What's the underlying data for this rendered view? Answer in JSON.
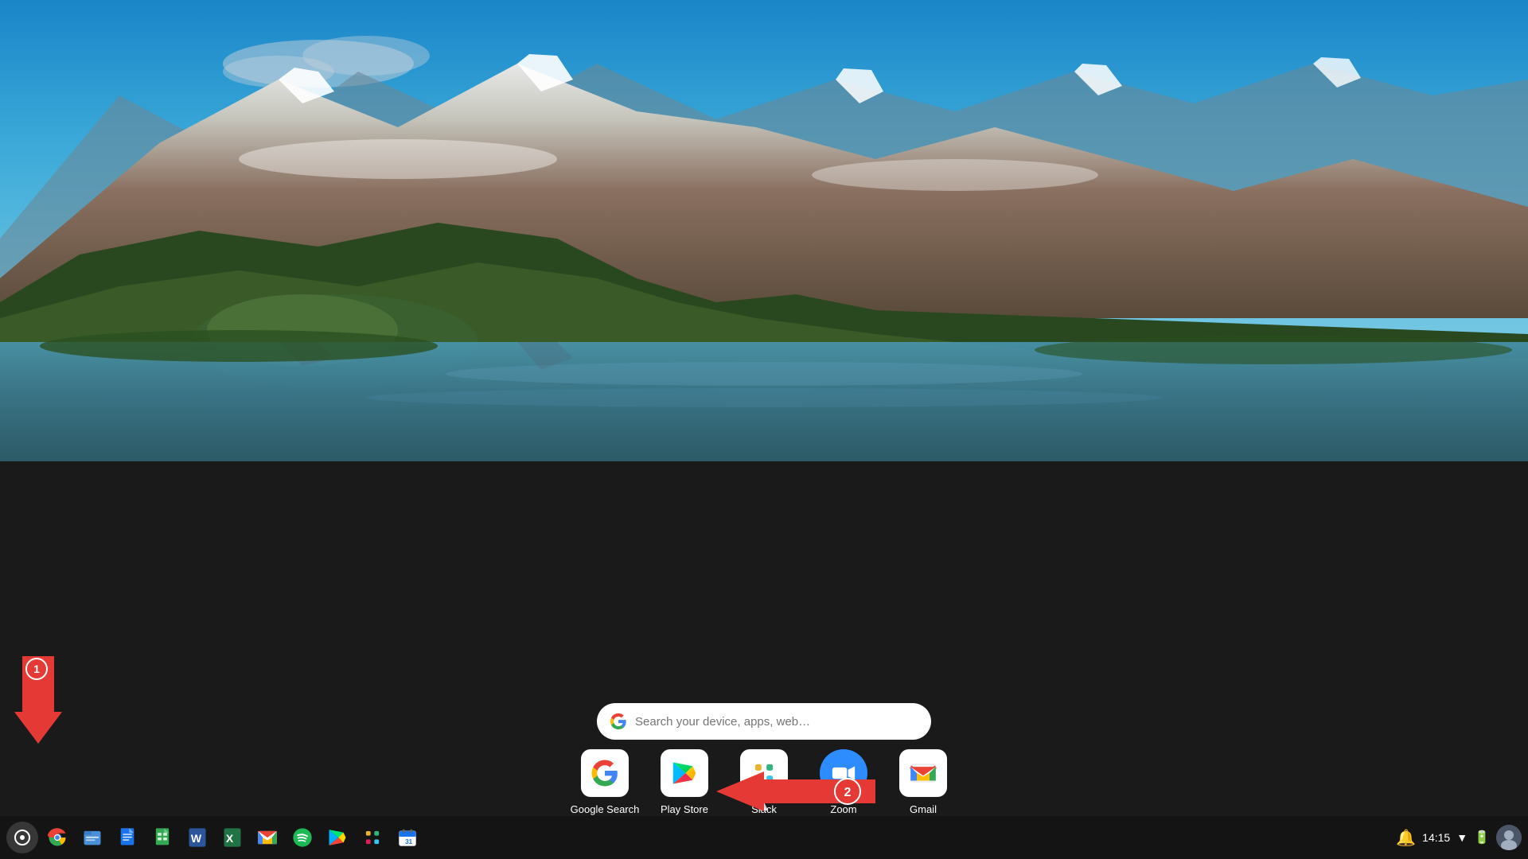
{
  "wallpaper": {
    "description": "Mountain landscape with lake reflection and blue sky"
  },
  "launcher": {
    "search_placeholder": "Search your device, apps, web…",
    "apps": [
      {
        "id": "google-search",
        "label": "Google Search",
        "icon": "google-search-icon",
        "color": "#ffffff"
      },
      {
        "id": "play-store",
        "label": "Play Store",
        "icon": "play-store-icon",
        "color": "#ffffff"
      },
      {
        "id": "slack",
        "label": "Slack",
        "icon": "slack-icon",
        "color": "#ffffff"
      },
      {
        "id": "zoom",
        "label": "Zoom",
        "icon": "zoom-icon",
        "color": "#2D8CFF"
      },
      {
        "id": "gmail",
        "label": "Gmail",
        "icon": "gmail-icon",
        "color": "#ffffff"
      }
    ]
  },
  "taskbar": {
    "icons": [
      {
        "id": "launcher",
        "icon": "⊙",
        "label": "Launcher"
      },
      {
        "id": "chrome",
        "icon": "chrome",
        "label": "Google Chrome"
      },
      {
        "id": "files",
        "icon": "files",
        "label": "Files"
      },
      {
        "id": "docs",
        "icon": "docs",
        "label": "Google Docs"
      },
      {
        "id": "sheets",
        "icon": "sheets",
        "label": "Google Sheets"
      },
      {
        "id": "word",
        "icon": "word",
        "label": "Microsoft Word"
      },
      {
        "id": "excel",
        "icon": "excel",
        "label": "Microsoft Excel"
      },
      {
        "id": "gmail-tb",
        "icon": "gmail-tb",
        "label": "Gmail"
      },
      {
        "id": "spotify",
        "icon": "spotify",
        "label": "Spotify"
      },
      {
        "id": "play-store-tb",
        "icon": "play-store-tb",
        "label": "Play Store"
      },
      {
        "id": "slack-tb",
        "icon": "slack-tb",
        "label": "Slack"
      },
      {
        "id": "calendar",
        "icon": "calendar",
        "label": "Google Calendar"
      }
    ],
    "clock": "14:15",
    "tray": {
      "notification": "🔔",
      "wifi": "▼",
      "battery": "🔋"
    }
  },
  "annotations": {
    "arrow1": {
      "number": "1",
      "direction": "down"
    },
    "arrow2": {
      "number": "2",
      "direction": "left"
    }
  }
}
